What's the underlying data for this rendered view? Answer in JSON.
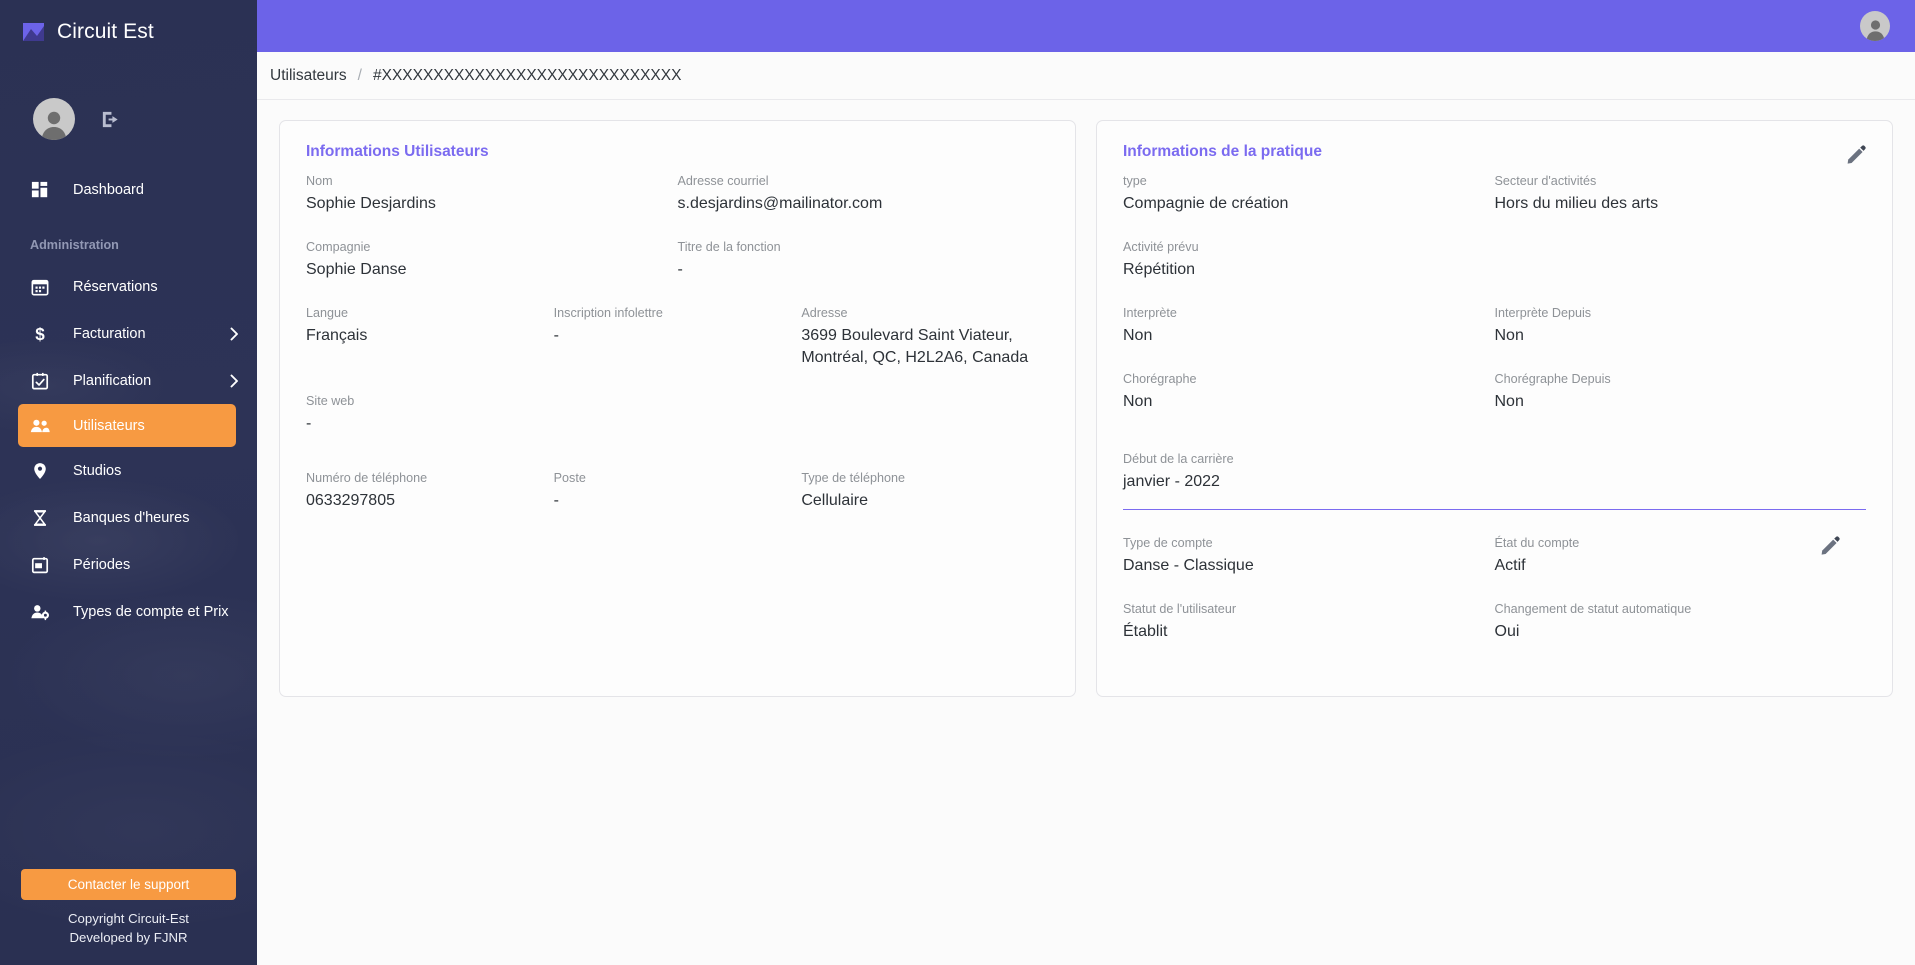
{
  "app": {
    "brand_title": "Circuit Est",
    "logo_icon": "circuit-est-logo-icon",
    "avatar_icon": "user-avatar-icon",
    "logout_icon": "logout-icon"
  },
  "sidebar": {
    "section_label": "Administration",
    "items": [
      {
        "label": "Dashboard",
        "icon": "dashboard-grid-icon",
        "active": false,
        "chevron": false
      },
      {
        "label": "Réservations",
        "icon": "calendar-icon",
        "active": false,
        "chevron": false
      },
      {
        "label": "Facturation",
        "icon": "dollar-icon",
        "active": false,
        "chevron": true
      },
      {
        "label": "Planification",
        "icon": "calendar-check-icon",
        "active": false,
        "chevron": true
      },
      {
        "label": "Utilisateurs",
        "icon": "users-icon",
        "active": true,
        "chevron": false
      },
      {
        "label": "Studios",
        "icon": "map-pin-icon",
        "active": false,
        "chevron": false
      },
      {
        "label": "Banques d'heures",
        "icon": "hourglass-icon",
        "active": false,
        "chevron": false
      },
      {
        "label": "Périodes",
        "icon": "period-calendar-icon",
        "active": false,
        "chevron": false
      },
      {
        "label": "Types de compte et Prix",
        "icon": "user-gear-icon",
        "active": false,
        "chevron": false
      }
    ],
    "support_button": "Contacter le support",
    "copyright_line1": "Copyright Circuit-Est",
    "copyright_line2": "Developed by FJNR"
  },
  "breadcrumb": {
    "root": "Utilisateurs",
    "separator": "/",
    "current": "#XXXXXXXXXXXXXXXXXXXXXXXXXXXXX"
  },
  "user_card": {
    "title": "Informations Utilisateurs",
    "fields": {
      "nom_label": "Nom",
      "nom_value": "Sophie Desjardins",
      "courriel_label": "Adresse courriel",
      "courriel_value": "s.desjardins@mailinator.com",
      "compagnie_label": "Compagnie",
      "compagnie_value": "Sophie Danse",
      "titre_fonction_label": "Titre de la fonction",
      "titre_fonction_value": "-",
      "langue_label": "Langue",
      "langue_value": "Français",
      "infolettre_label": "Inscription infolettre",
      "infolettre_value": "-",
      "adresse_label": "Adresse",
      "adresse_value": "3699 Boulevard Saint Viateur,\nMontréal, QC, H2L2A6, Canada",
      "site_web_label": "Site web",
      "site_web_value": "-",
      "telephone_label": "Numéro de téléphone",
      "telephone_value": "0633297805",
      "poste_label": "Poste",
      "poste_value": "-",
      "type_telephone_label": "Type de téléphone",
      "type_telephone_value": "Cellulaire"
    }
  },
  "practice_card": {
    "title": "Informations de la pratique",
    "edit_icon": "edit-pencil-icon",
    "fields": {
      "type_label": "type",
      "type_value": "Compagnie de création",
      "secteur_label": "Secteur d'activités",
      "secteur_value": "Hors du milieu des arts",
      "activite_label": "Activité prévu",
      "activite_value": "Répétition",
      "interprete_label": "Interprète",
      "interprete_value": "Non",
      "interprete_depuis_label": "Interprète Depuis",
      "interprete_depuis_value": "Non",
      "choregraphe_label": "Chorégraphe",
      "choregraphe_value": "Non",
      "choregraphe_depuis_label": "Chorégraphe Depuis",
      "choregraphe_depuis_value": "Non",
      "debut_carriere_label": "Début de la carrière",
      "debut_carriere_value": "janvier - 2022"
    }
  },
  "account_section": {
    "edit_icon": "edit-pencil-icon",
    "fields": {
      "type_compte_label": "Type de compte",
      "type_compte_value": "Danse - Classique",
      "etat_compte_label": "État du compte",
      "etat_compte_value": "Actif",
      "statut_utilisateur_label": "Statut de l'utilisateur",
      "statut_utilisateur_value": "Établit",
      "changement_statut_label": "Changement de statut automatique",
      "changement_statut_value": "Oui"
    }
  },
  "colors": {
    "sidebar_bg": "#2b3154",
    "accent_orange": "#f79a42",
    "header_purple": "#6c63e8",
    "title_purple": "#7b6bf0",
    "text_dark": "#2d3238",
    "label_grey": "#8e9297"
  }
}
